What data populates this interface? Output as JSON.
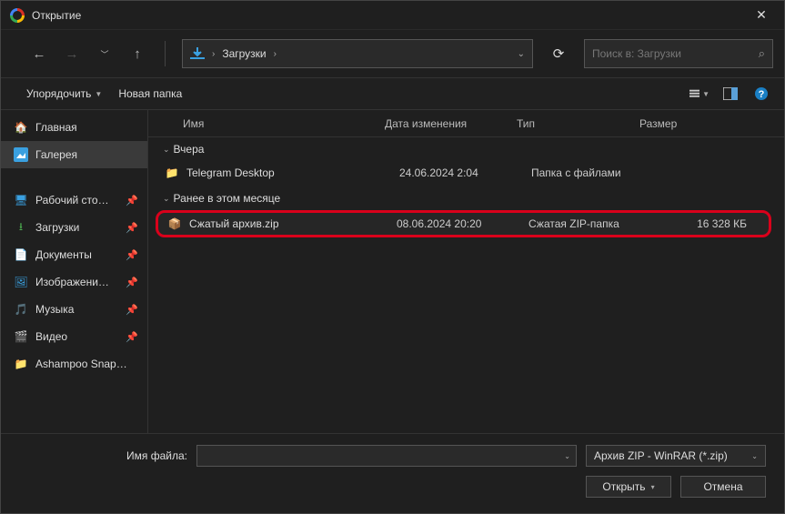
{
  "window": {
    "title": "Открытие"
  },
  "breadcrumb": {
    "folder": "Загрузки"
  },
  "search": {
    "placeholder": "Поиск в: Загрузки"
  },
  "toolbar": {
    "organize": "Упорядочить",
    "new_folder": "Новая папка"
  },
  "sidebar": {
    "home": "Главная",
    "gallery": "Галерея",
    "items": [
      {
        "label": "Рабочий сто…"
      },
      {
        "label": "Загрузки"
      },
      {
        "label": "Документы"
      },
      {
        "label": "Изображени…"
      },
      {
        "label": "Музыка"
      },
      {
        "label": "Видео"
      },
      {
        "label": "Ashampoo Snap…"
      }
    ]
  },
  "columns": {
    "name": "Имя",
    "date": "Дата изменения",
    "type": "Тип",
    "size": "Размер"
  },
  "groups": {
    "yesterday": "Вчера",
    "earlier": "Ранее в этом месяце"
  },
  "rows": {
    "telegram": {
      "name": "Telegram Desktop",
      "date": "24.06.2024 2:04",
      "type": "Папка с файлами",
      "size": ""
    },
    "zip": {
      "name": "Сжатый архив.zip",
      "date": "08.06.2024 20:20",
      "type": "Сжатая ZIP-папка",
      "size": "16 328 КБ"
    }
  },
  "footer": {
    "filename_label": "Имя файла:",
    "filter": "Архив ZIP - WinRAR (*.zip)",
    "open": "Открыть",
    "cancel": "Отмена"
  }
}
